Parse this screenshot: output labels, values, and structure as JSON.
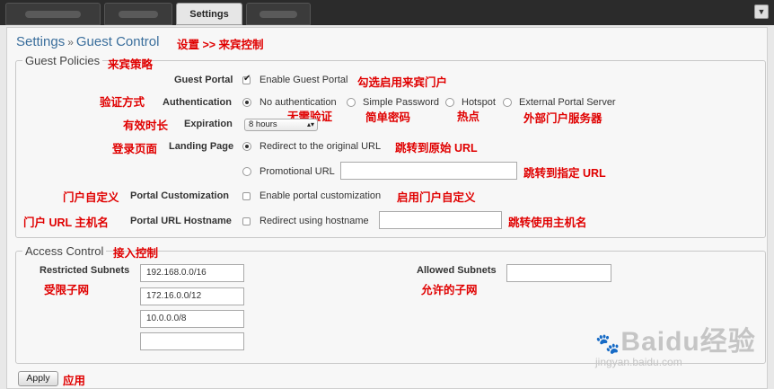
{
  "tabs": {
    "active": "Settings"
  },
  "breadcrumb": {
    "root": "Settings",
    "separator": "»",
    "current": "Guest Control"
  },
  "guest_policies": {
    "legend": "Guest Policies",
    "guest_portal": {
      "label": "Guest Portal",
      "option": "Enable Guest Portal",
      "checked": true
    },
    "authentication": {
      "label": "Authentication",
      "options": [
        "No authentication",
        "Simple Password",
        "Hotspot",
        "External Portal Server"
      ],
      "selected": "No authentication"
    },
    "expiration": {
      "label": "Expiration",
      "value": "8 hours"
    },
    "landing_page": {
      "label": "Landing Page",
      "redirect_option": "Redirect to the original URL",
      "promotional_option": "Promotional URL",
      "promotional_value": ""
    },
    "portal_customization": {
      "label": "Portal Customization",
      "option": "Enable portal customization"
    },
    "portal_hostname": {
      "label": "Portal URL Hostname",
      "option": "Redirect using hostname",
      "value": ""
    }
  },
  "access_control": {
    "legend": "Access Control",
    "restricted_label": "Restricted Subnets",
    "restricted_subnets": [
      "192.168.0.0/16",
      "172.16.0.0/12",
      "10.0.0.0/8",
      ""
    ],
    "allowed_label": "Allowed Subnets",
    "allowed_value": ""
  },
  "apply_label": "Apply",
  "annotations": {
    "crumb": "设置 >> 来宾控制",
    "policies": "来宾策略",
    "enable_portal": "勾选启用来宾门户",
    "auth_method": "验证方式",
    "no_auth": "无需验证",
    "simple_pw": "简单密码",
    "hotspot": "热点",
    "external": "外部门户服务器",
    "expiration": "有效时长",
    "landing": "登录页面",
    "redirect": "跳转到原始 URL",
    "promo": "跳转到指定 URL",
    "custom_left": "门户自定义",
    "custom_right": "启用门户自定义",
    "hostname_left": "门户 URL 主机名",
    "hostname_right": "跳转使用主机名",
    "access": "接入控制",
    "restricted": "受限子网",
    "allowed": "允许的子网",
    "apply": "应用"
  },
  "watermark": {
    "logo": "Baidu经验",
    "url": "jingyan.baidu.com"
  },
  "colors": {
    "annotation": "#e00000",
    "link": "#3a6e9c",
    "topbar": "#2b2b2b"
  }
}
